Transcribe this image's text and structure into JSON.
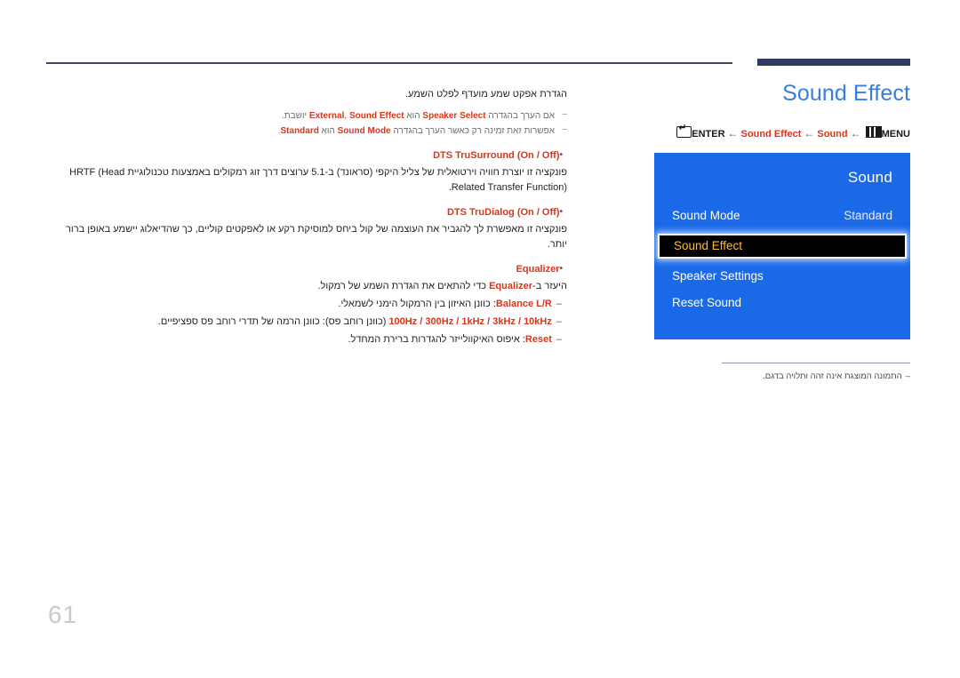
{
  "page": {
    "number": "61",
    "title": "Sound Effect"
  },
  "breadcrumb": {
    "enter_icon": "enter-key-icon",
    "enter_label": "ENTER",
    "arrow": "←",
    "step_sound_effect": "Sound Effect",
    "step_sound": "Sound",
    "menu_icon": "menu-key-icon",
    "menu_label": "MENU"
  },
  "osd": {
    "title": "Sound",
    "items": [
      {
        "label": "Sound Mode",
        "value": "Standard",
        "selected": false
      },
      {
        "label": "Sound Effect",
        "value": "",
        "selected": true
      },
      {
        "label": "Speaker Settings",
        "value": "",
        "selected": false
      },
      {
        "label": "Reset Sound",
        "value": "",
        "selected": false
      }
    ],
    "colors": {
      "panel_bg": "#1a6ae8",
      "selected_bg": "#000000",
      "selected_text": "#ffbb33"
    }
  },
  "osd_note": {
    "dash": "–",
    "text": "התמונה המוצגת אינה זהה ותלויה בדגם."
  },
  "content": {
    "lead": "הגדרת אפקט שמע מועדף לפלט השמע.",
    "notes": [
      {
        "dash": "–",
        "pre": "אם הערך בהגדרה ",
        "kw1": "Speaker Select",
        "mid1": " הוא ",
        "kw2": "External",
        "mid2": ", ",
        "kw3": "Sound Effect",
        "post": " יושבת."
      },
      {
        "dash": "–",
        "pre": "אפשרות זאת זמינה רק כאשר הערך בהגדרה ",
        "kw1": "Sound Mode",
        "mid1": " הוא ",
        "kw2": "Standard",
        "mid2": "",
        "kw3": "",
        "post": "."
      }
    ],
    "bullets": [
      {
        "dot": "•",
        "heading_name": "DTS TruSurround",
        "heading_options": "(On / Off)",
        "body": "פונקציה זו יוצרת חוויה וירטואלית של צליל היקפי (סראונד) ב-5.1 ערוצים דרך זוג רמקולים באמצעות טכנולוגיית HRTF (Head Related Transfer Function)."
      },
      {
        "dot": "•",
        "heading_name": "DTS TruDialog",
        "heading_options": "(On / Off)",
        "body": "פונקציה זו מאפשרת לך להגביר את העוצמה של קול ביחס למוסיקת רקע או לאפקטים קוליים, כך שהדיאלוג יישמע באופן ברור יותר."
      }
    ],
    "equalizer": {
      "dot": "•",
      "heading_name": "Equalizer",
      "body_pre": "היעזר ב-",
      "body_kw": "Equalizer",
      "body_post": " כדי להתאים את הגדרת השמע של רמקול.",
      "sub_items": [
        {
          "dash": "–",
          "kw": "Balance L/R",
          "text": ": כוונן האיזון בין הרמקול הימני לשמאלי."
        },
        {
          "dash": "–",
          "kw": "100Hz / 300Hz / 1kHz / 3kHz / 10kHz",
          "text": " (כוונן רוחב פס): כוונן הרמה של תדרי רוחב פס ספציפיים."
        },
        {
          "dash": "–",
          "kw": "Reset",
          "text": ": איפוס האיקוולייזר להגדרות ברירת המחדל."
        }
      ]
    }
  }
}
